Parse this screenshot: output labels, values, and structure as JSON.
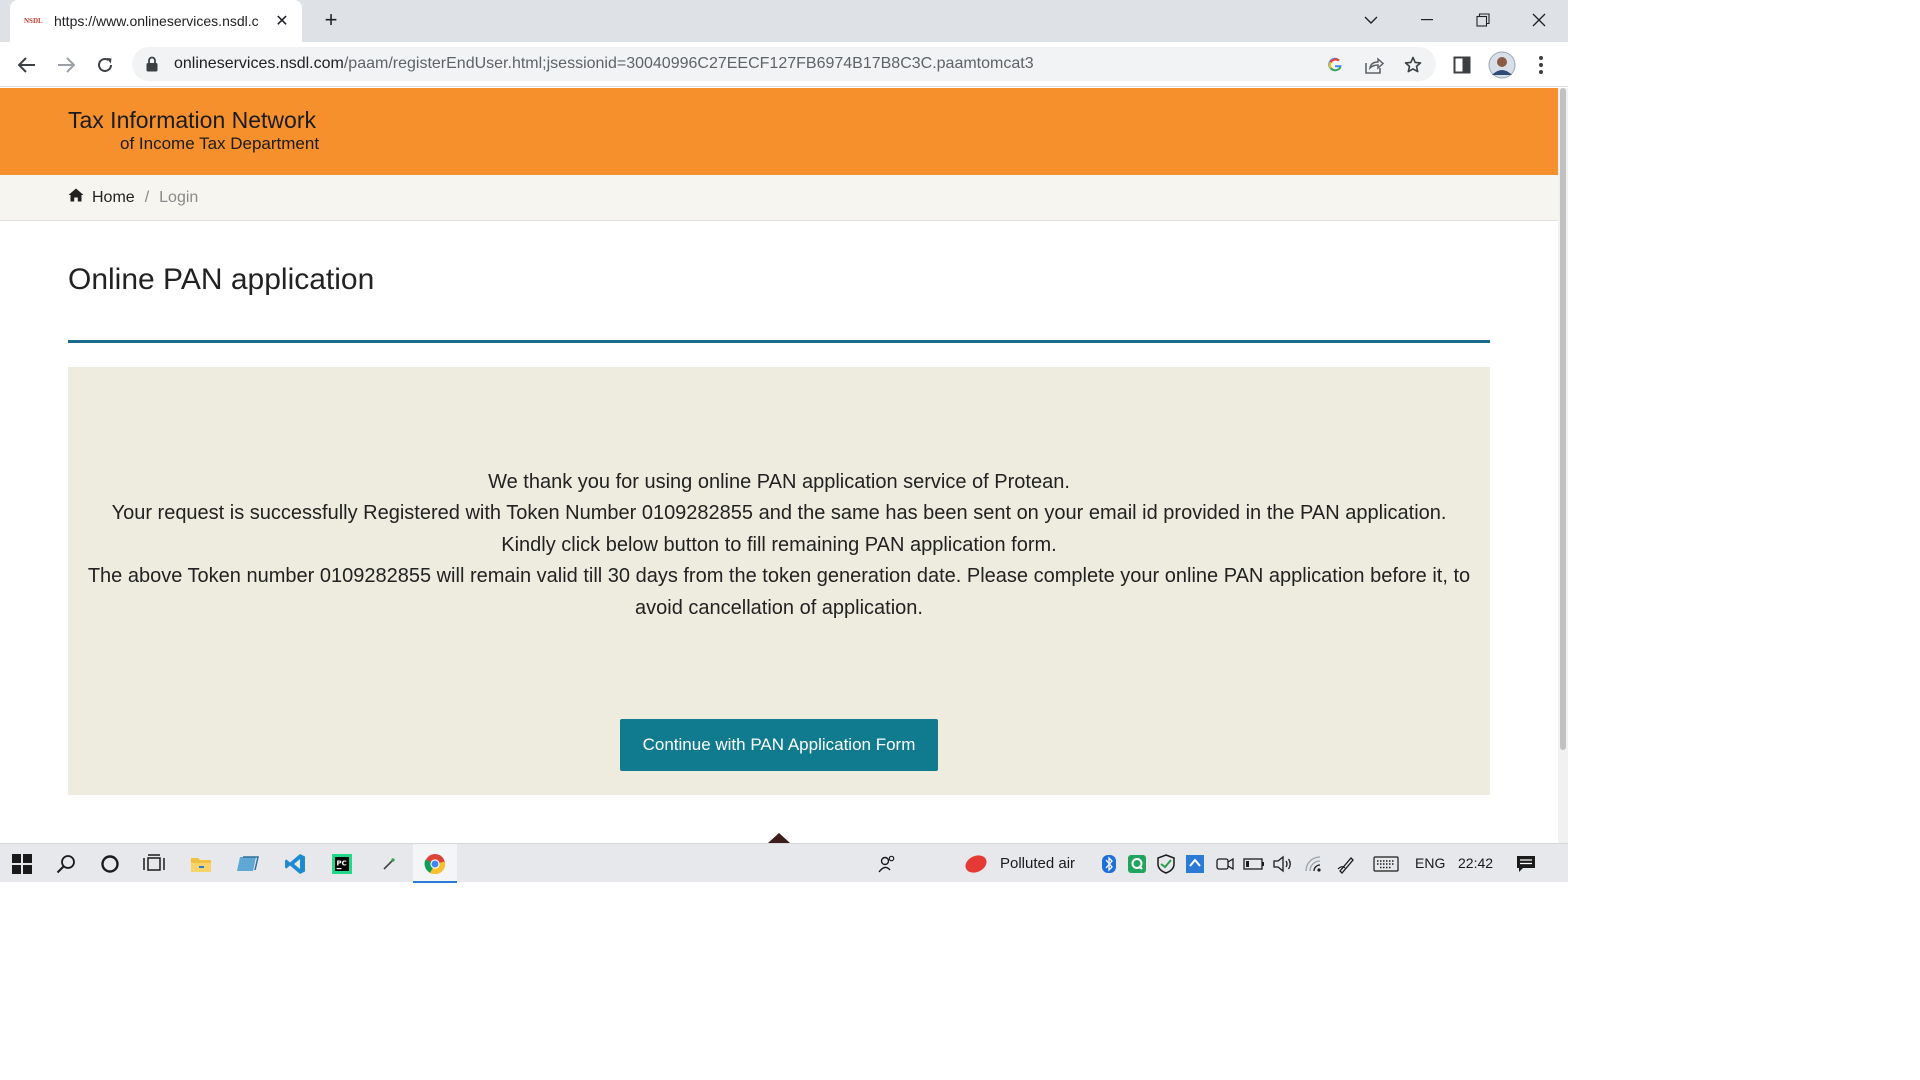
{
  "browser": {
    "tab": {
      "favicon_text": "NSDL",
      "title": "https://www.onlineservices.nsdl.c",
      "close": "✕"
    },
    "new_tab": "+",
    "address": {
      "host": "onlineservices.nsdl.com",
      "path": "/paam/registerEndUser.html;jsessionid=30040996C27EECF127FB6974B17B8C3C.paamtomcat3"
    }
  },
  "site": {
    "brand_line1": "Tax Information Network",
    "brand_line2": "of Income Tax Department",
    "header_color": "#f6902d"
  },
  "breadcrumb": {
    "home": "Home",
    "separator": "/",
    "current": "Login"
  },
  "main": {
    "title": "Online PAN application",
    "messages": [
      "We thank you for using online PAN application service of Protean.",
      "Your request is successfully Registered with Token Number 0109282855 and the same has been sent on your email id provided in the PAN application.",
      "Kindly click below button to fill remaining PAN application form.",
      "The above Token number 0109282855 will remain valid till 30 days from the token generation date. Please complete your online PAN application before it, to avoid cancellation of application."
    ],
    "cta_label": "Continue with PAN Application Form",
    "accent_color": "#107a8e"
  },
  "taskbar": {
    "weather": "Polluted air",
    "language": "ENG",
    "time": "22:42",
    "pycharm_label": "PC"
  }
}
